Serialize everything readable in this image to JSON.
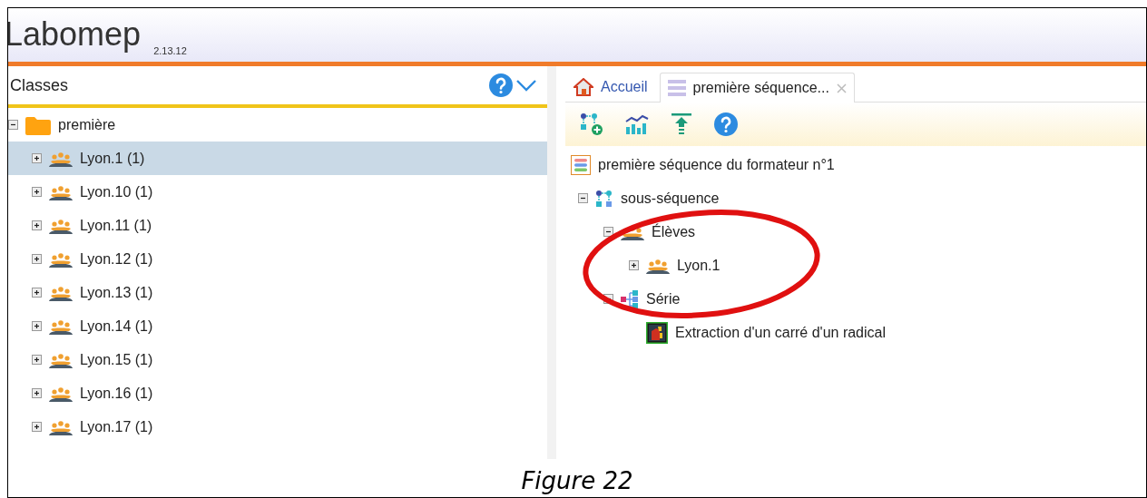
{
  "app": {
    "title": "Labomep",
    "version": "2.13.12"
  },
  "left_panel": {
    "title": "Classes",
    "tree": [
      {
        "label": "première",
        "kind": "folder",
        "expanded": true,
        "selected": false,
        "children": [
          {
            "label": "Lyon.1 (1)",
            "kind": "group",
            "expanded": false,
            "selected": true
          },
          {
            "label": "Lyon.10 (1)",
            "kind": "group",
            "expanded": false,
            "selected": false
          },
          {
            "label": "Lyon.11 (1)",
            "kind": "group",
            "expanded": false,
            "selected": false
          },
          {
            "label": "Lyon.12 (1)",
            "kind": "group",
            "expanded": false,
            "selected": false
          },
          {
            "label": "Lyon.13 (1)",
            "kind": "group",
            "expanded": false,
            "selected": false
          },
          {
            "label": "Lyon.14 (1)",
            "kind": "group",
            "expanded": false,
            "selected": false
          },
          {
            "label": "Lyon.15 (1)",
            "kind": "group",
            "expanded": false,
            "selected": false
          },
          {
            "label": "Lyon.16 (1)",
            "kind": "group",
            "expanded": false,
            "selected": false
          },
          {
            "label": "Lyon.17 (1)",
            "kind": "group",
            "expanded": false,
            "selected": false
          }
        ]
      }
    ]
  },
  "tabs": [
    {
      "label": "Accueil",
      "kind": "home",
      "selected": false
    },
    {
      "label": "première séquence...",
      "kind": "sequence",
      "selected": true,
      "closable": true
    }
  ],
  "sequence_title": "première séquence du formateur n°1",
  "sequence_tree": [
    {
      "label": "sous-séquence",
      "kind": "subsequence",
      "expanded": true,
      "children": [
        {
          "label": "Élèves",
          "kind": "group",
          "expanded": true,
          "children": [
            {
              "label": "Lyon.1",
              "kind": "group",
              "expanded": false
            }
          ]
        },
        {
          "label": "Série",
          "kind": "series",
          "expanded": true,
          "children": [
            {
              "label": "Extraction d'un carré d'un radical",
              "kind": "exercise"
            }
          ]
        }
      ]
    }
  ],
  "caption": "Figure 22"
}
